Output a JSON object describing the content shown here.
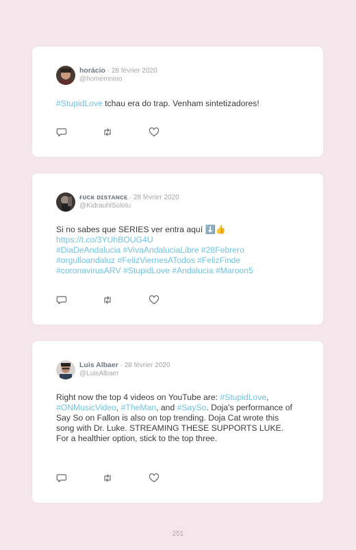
{
  "tweets": [
    {
      "name": "horácio",
      "date": "28 février 2020",
      "handle": "@homemnino",
      "body": [
        {
          "t": "#StupidLove",
          "tag": true
        },
        {
          "t": " tchau era do trap. Venham sintetizadores!",
          "tag": false
        }
      ]
    },
    {
      "name": "ғᴜᴄᴋ ᴅɪsᴛᴀɴᴄᴇ",
      "date": "28 février 2020",
      "handle": "@KidrauhlSolotu",
      "body": [
        {
          "t": "Si no sabes que SERIES ver entra aquí ⬇️👍",
          "tag": false
        },
        {
          "br": true
        },
        {
          "t": "https://t.co/3YUhBOUG4U",
          "tag": true
        },
        {
          "br": true
        },
        {
          "t": "#DiaDeAndalucia",
          "tag": true
        },
        {
          "t": " ",
          "tag": false
        },
        {
          "t": "#VivaAndaluciaLibre",
          "tag": true
        },
        {
          "t": " ",
          "tag": false
        },
        {
          "t": "#28Febrero",
          "tag": true
        },
        {
          "br": true
        },
        {
          "t": "#orgulloandaluz",
          "tag": true
        },
        {
          "t": " ",
          "tag": false
        },
        {
          "t": "#FelizViernesATodos",
          "tag": true
        },
        {
          "t": " ",
          "tag": false
        },
        {
          "t": "#FelizFinde",
          "tag": true
        },
        {
          "br": true
        },
        {
          "t": "#coronavirusARV",
          "tag": true
        },
        {
          "t": " ",
          "tag": false
        },
        {
          "t": "#StupidLove",
          "tag": true
        },
        {
          "t": " ",
          "tag": false
        },
        {
          "t": "#Andalucia",
          "tag": true
        },
        {
          "t": " ",
          "tag": false
        },
        {
          "t": "#Maroon5",
          "tag": true
        }
      ]
    },
    {
      "name": "Luis Albaer",
      "date": "28 février 2020",
      "handle": "@LuisAlbaer",
      "body": [
        {
          "t": "Right now the top 4 videos on YouTube are: ",
          "tag": false
        },
        {
          "t": "#StupidLove",
          "tag": true
        },
        {
          "t": ", ",
          "tag": false
        },
        {
          "t": "#ONMusicVideo",
          "tag": true
        },
        {
          "t": ", ",
          "tag": false
        },
        {
          "t": "#TheMan",
          "tag": true
        },
        {
          "t": ", and ",
          "tag": false
        },
        {
          "t": "#SaySo",
          "tag": true
        },
        {
          "t": ". Doja's performance of Say So on Fallon is also on top trending. Doja Cat wrote this song with Dr. Luke. STREAMING THESE SUPPORTS LUKE. For a healthier option, stick to the top three.",
          "tag": false
        }
      ]
    }
  ],
  "separator": " · ",
  "icons": [
    "reply-icon",
    "retweet-icon",
    "like-icon"
  ],
  "colors": {
    "background": "#f4e6ea",
    "card": "#ffffff",
    "hashtag": "#6ec3e6"
  },
  "page_number": "251"
}
